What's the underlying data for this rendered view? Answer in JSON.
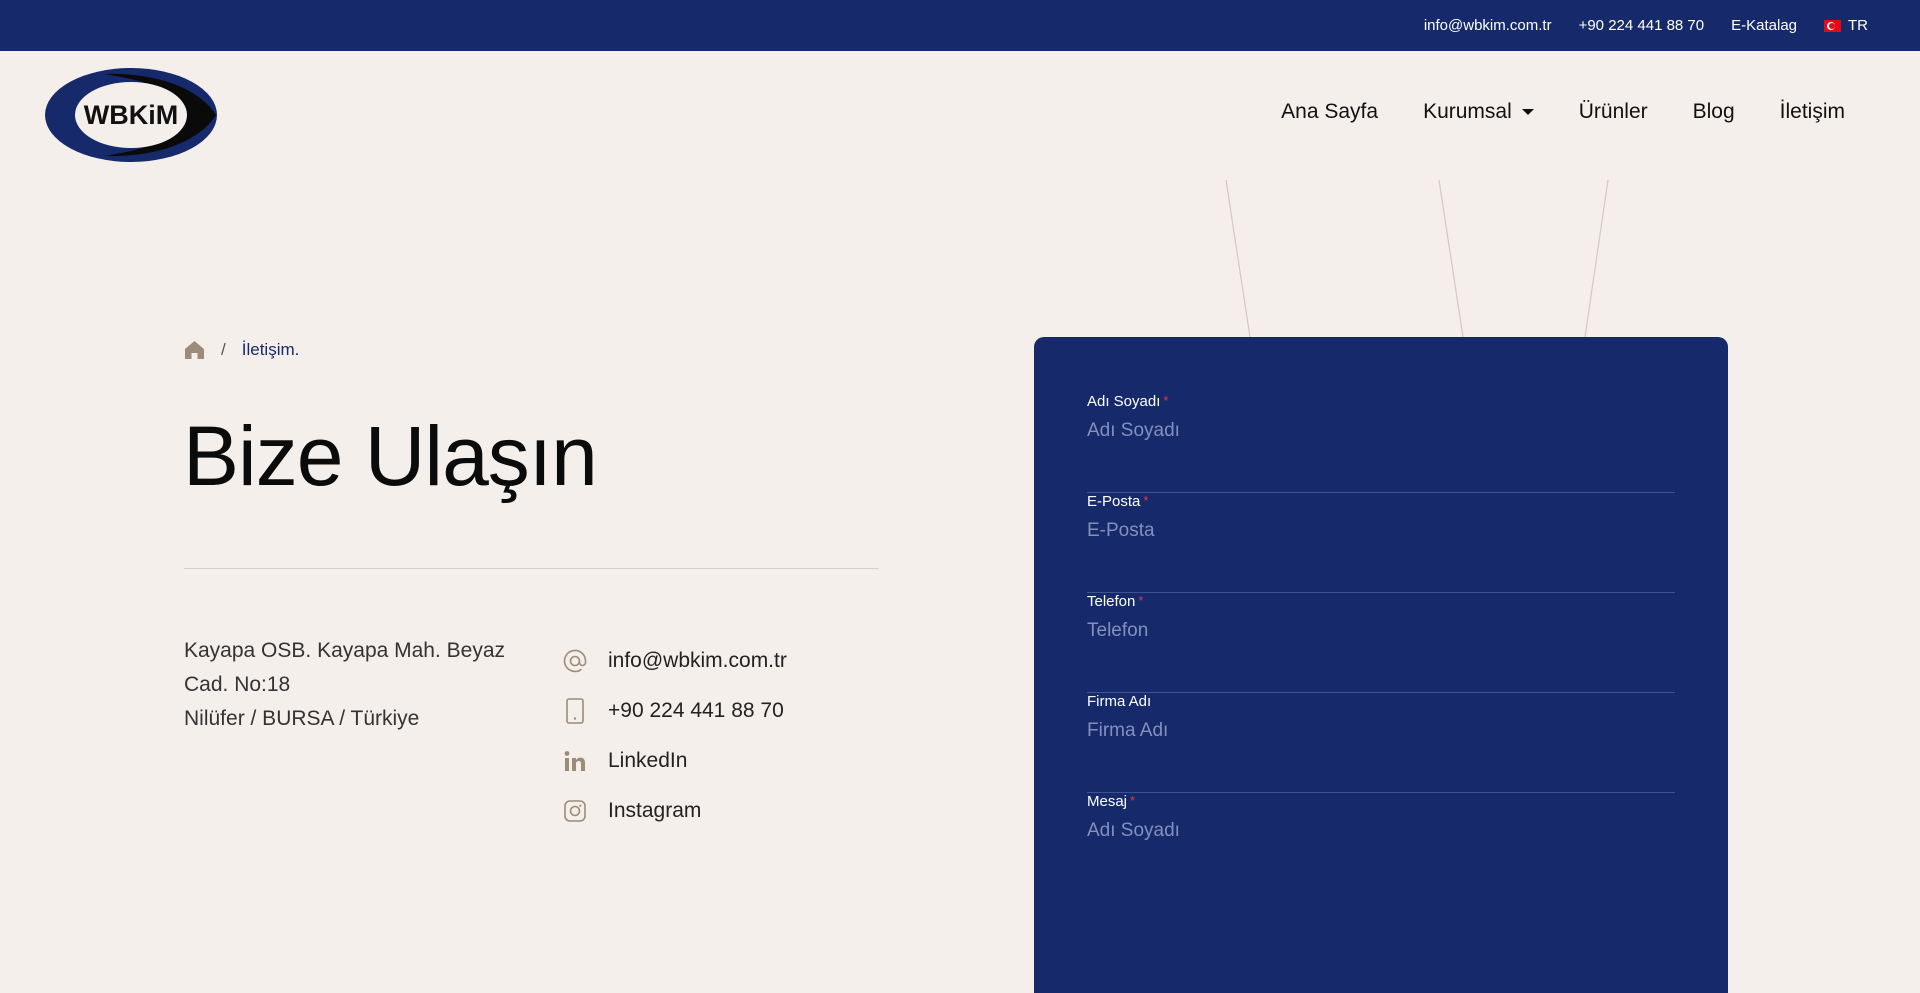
{
  "topbar": {
    "email": "info@wbkim.com.tr",
    "phone": "+90 224 441 88 70",
    "catalog": "E-Katalag",
    "lang": "TR"
  },
  "logo": {
    "text": "WBKiM"
  },
  "nav": {
    "home": "Ana Sayfa",
    "corporate": "Kurumsal",
    "products": "Ürünler",
    "blog": "Blog",
    "contact": "İletişim"
  },
  "breadcrumb": {
    "separator": "/",
    "current": "İletişim."
  },
  "page": {
    "title": "Bize Ulaşın"
  },
  "address": {
    "line1": "Kayapa OSB. Kayapa Mah. Beyaz",
    "line2": "Cad. No:18",
    "line3": "Nilüfer / BURSA / Türkiye"
  },
  "contacts": {
    "email": "info@wbkim.com.tr",
    "phone": "+90 224 441 88 70",
    "linkedin": "LinkedIn",
    "instagram": "Instagram"
  },
  "form": {
    "name": {
      "label": "Adı Soyadı",
      "required": "*",
      "placeholder": "Adı Soyadı"
    },
    "email": {
      "label": "E-Posta",
      "required": "*",
      "placeholder": "E-Posta"
    },
    "phone": {
      "label": "Telefon",
      "required": "*",
      "placeholder": "Telefon"
    },
    "company": {
      "label": "Firma Adı",
      "placeholder": "Firma Adı"
    },
    "message": {
      "label": "Mesaj",
      "required": "*",
      "placeholder": "Adı Soyadı"
    }
  },
  "colors": {
    "primary": "#16296b",
    "background": "#f5efec",
    "icon": "#9a8c78",
    "required": "#e5364b"
  }
}
